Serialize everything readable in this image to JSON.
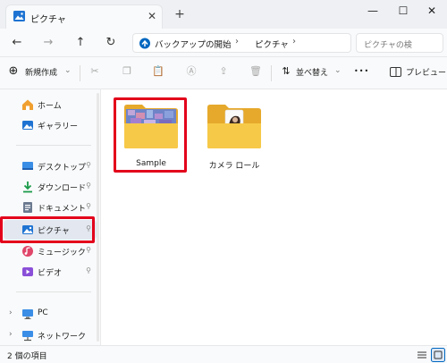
{
  "window": {
    "tab_title": "ピクチャ",
    "close_tab": "✕",
    "new_tab": "+",
    "minimize": "—",
    "maximize": "☐",
    "close": "✕"
  },
  "address_bar": {
    "back": "←",
    "forward": "→",
    "up": "↑",
    "refresh": "↻",
    "path": [
      "バックアップの開始",
      "ピクチャ"
    ],
    "chevron": "›",
    "search_placeholder": "ピクチャの検"
  },
  "command_bar": {
    "new_label": "新規作成",
    "new_dropdown": "⌄",
    "sort_label": "並べ替え",
    "sort_dropdown": "⌄",
    "more": "•••",
    "preview_label": "プレビュー"
  },
  "sidebar": {
    "items": [
      {
        "label": "ホーム",
        "icon": "home-icon"
      },
      {
        "label": "ギャラリー",
        "icon": "gallery-icon"
      },
      {
        "label": "デスクトップ",
        "icon": "desktop-icon",
        "pinned": true
      },
      {
        "label": "ダウンロード",
        "icon": "download-icon",
        "pinned": true
      },
      {
        "label": "ドキュメント",
        "icon": "document-icon",
        "pinned": true
      },
      {
        "label": "ピクチャ",
        "icon": "pictures-icon",
        "pinned": true,
        "selected": true
      },
      {
        "label": "ミュージック",
        "icon": "music-icon",
        "pinned": true
      },
      {
        "label": "ビデオ",
        "icon": "video-icon",
        "pinned": true
      },
      {
        "label": "PC",
        "icon": "pc-icon",
        "expandable": true
      },
      {
        "label": "ネットワーク",
        "icon": "network-icon",
        "expandable": true
      }
    ],
    "pin_glyph": "📌",
    "expand_glyph": "›"
  },
  "content": {
    "folders": [
      {
        "name": "Sample",
        "highlighted": true
      },
      {
        "name": "カメラ ロール",
        "highlighted": false
      }
    ]
  },
  "status_bar": {
    "item_count": "2 個の項目"
  },
  "colors": {
    "highlight": "#e3001b",
    "folder": "#f7c948",
    "folder_dark": "#e6a92b",
    "accent": "#0067c0"
  }
}
